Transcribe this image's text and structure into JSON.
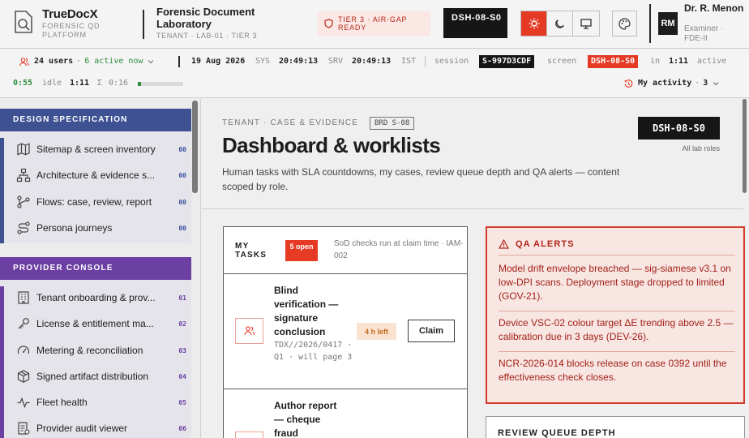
{
  "header": {
    "brand": {
      "name": "TrueDocX",
      "sub1": "FORENSIC QD",
      "sub2": "PLATFORM"
    },
    "lab": {
      "title": "Forensic Document Laboratory",
      "sub": "TENANT · LAB-01 · TIER 3"
    },
    "tier_badge": "TIER 3 · AIR-GAP READY",
    "screen_id": "DSH-08-S0",
    "theme_buttons": [
      "sun-icon",
      "moon-icon",
      "monitor-icon"
    ],
    "user": {
      "initials": "RM",
      "name": "Dr. R. Menon",
      "role1": "Examiner ·",
      "role2": "FDE-II"
    }
  },
  "status": {
    "users": "24 users",
    "active": "6 active now",
    "date": "19 Aug 2026",
    "sys_label": "SYS",
    "sys_time": "20:49:13",
    "srv_label": "SRV",
    "srv_time": "20:49:13",
    "tz": "IST",
    "session_label": "session",
    "session_id": "S-997D3CDF",
    "screen_label": "screen",
    "screen_id": "DSH-08-S0",
    "in_label": "in",
    "in_value": "1:11",
    "active_label": "active",
    "active_value": "0:55",
    "idle_label": "idle",
    "idle_value": "1:11",
    "sum_label": "Σ",
    "sum_value": "0:16",
    "idle_progress": 0.08,
    "my_activity": "My activity",
    "my_activity_count": "3"
  },
  "sidebar": {
    "sections": [
      {
        "title": "DESIGN SPECIFICATION",
        "color": "#3d5193",
        "items": [
          {
            "label": "Sitemap & screen inventory",
            "num": "00",
            "icon": "map-icon"
          },
          {
            "label": "Architecture & evidence s...",
            "num": "00",
            "icon": "sitemap-icon"
          },
          {
            "label": "Flows: case, review, report",
            "num": "00",
            "icon": "flow-icon"
          },
          {
            "label": "Persona journeys",
            "num": "00",
            "icon": "route-icon"
          }
        ]
      },
      {
        "title": "PROVIDER CONSOLE",
        "color": "#6c3fa2",
        "items": [
          {
            "label": "Tenant onboarding & prov...",
            "num": "01",
            "icon": "building-icon"
          },
          {
            "label": "License & entitlement ma...",
            "num": "02",
            "icon": "key-icon"
          },
          {
            "label": "Metering & reconciliation",
            "num": "03",
            "icon": "gauge-icon"
          },
          {
            "label": "Signed artifact distribution",
            "num": "04",
            "icon": "package-icon"
          },
          {
            "label": "Fleet health",
            "num": "05",
            "icon": "pulse-icon"
          },
          {
            "label": "Provider audit viewer",
            "num": "06",
            "icon": "log-icon"
          }
        ]
      }
    ]
  },
  "page": {
    "crumb": "TENANT · CASE & EVIDENCE",
    "brd": "BRD S-08",
    "title": "Dashboard & worklists",
    "description": "Human tasks with SLA countdowns, my cases, review queue depth and QA alerts — content scoped by role.",
    "screen_id": "DSH-08-S0",
    "roles": "All lab roles"
  },
  "tasks": {
    "title": "MY TASKS",
    "count": "5 open",
    "note": "SoD checks run at claim time · IAM-002",
    "items": [
      {
        "title": "Blind verification — signature conclusion",
        "meta": "TDX//2026/0417 · Q1 · will page 3",
        "sla": "4 h left",
        "action": "Claim",
        "icon": "users-icon"
      },
      {
        "title": "Author report — cheque fraud",
        "meta": "",
        "sla": "",
        "action": "",
        "icon": "users-icon"
      }
    ]
  },
  "qa_alerts": {
    "title": "QA ALERTS",
    "items": [
      "Model drift envelope breached — sig-siamese v3.1 on low-DPI scans. Deployment stage dropped to limited (GOV-21).",
      "Device VSC-02 colour target ΔE trending above 2.5 — calibration due in 3 days (DEV-26).",
      "NCR-2026-014 blocks release on case 0392 until the effectiveness check closes."
    ]
  },
  "review_queue": {
    "title": "REVIEW QUEUE DEPTH"
  }
}
